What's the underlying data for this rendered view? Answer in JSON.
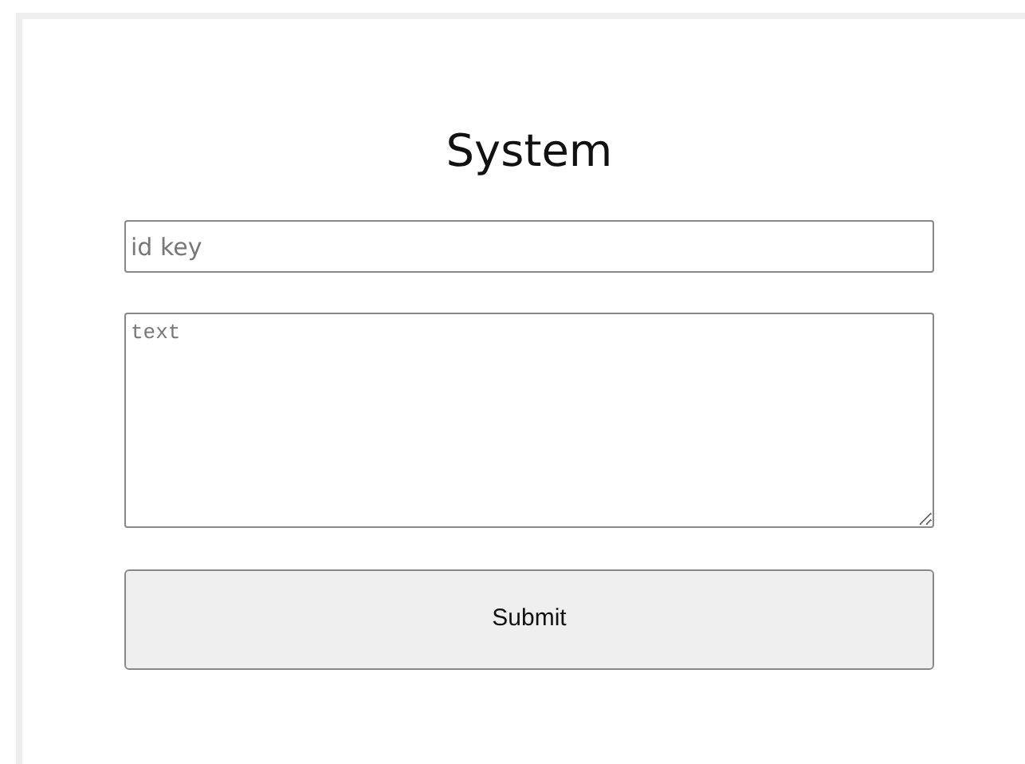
{
  "title": "System",
  "id_field": {
    "placeholder": "id key"
  },
  "text_field": {
    "placeholder": "text"
  },
  "submit_button": {
    "label": "Submit"
  }
}
